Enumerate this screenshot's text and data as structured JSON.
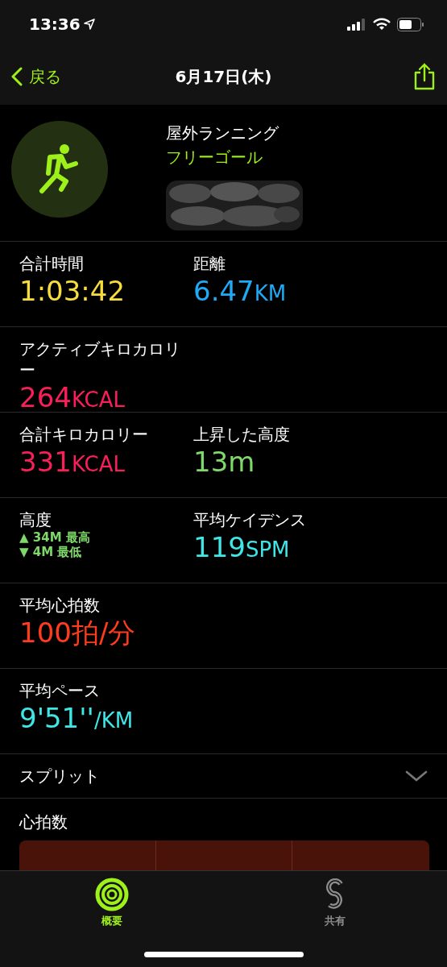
{
  "status_bar": {
    "time": "13:36"
  },
  "nav": {
    "back": "戻る",
    "title": "6月17日(木)"
  },
  "workout": {
    "name": "屋外ランニング",
    "goal": "フリーゴール"
  },
  "rows": [
    {
      "cells": [
        {
          "kind": "metric",
          "label": "合計時間",
          "value": "1:03:42",
          "color": "#f7dc3c"
        },
        {
          "kind": "metric",
          "label": "距離",
          "value": "6.47",
          "unit": "KM",
          "color": "#1eaaf5"
        }
      ]
    },
    {
      "cells": [
        {
          "kind": "metric",
          "label": "アクティブキロカロリー",
          "value": "264",
          "unit": "KCAL",
          "color": "#fa1e5a"
        }
      ]
    },
    {
      "cells": [
        {
          "kind": "metric",
          "label": "合計キロカロリー",
          "value": "331",
          "unit": "KCAL",
          "color": "#fa1e5a"
        },
        {
          "kind": "metric",
          "label": "上昇した高度",
          "value": "13m",
          "color": "#7fd86a"
        }
      ]
    },
    {
      "cells": [
        {
          "kind": "range",
          "label": "高度",
          "high": "▲ 34M 最高",
          "low": "▼ 4M 最低",
          "color": "#7fd86a"
        },
        {
          "kind": "metric",
          "label": "平均ケイデンス",
          "value": "119",
          "unit": "SPM",
          "color": "#3ee6e6"
        }
      ]
    },
    {
      "cells": [
        {
          "kind": "metric",
          "label": "平均心拍数",
          "value": "100拍/分",
          "color": "#ff3b1e"
        }
      ]
    },
    {
      "cells": [
        {
          "kind": "metric",
          "label": "平均ペース",
          "value": "9'51''",
          "unit": "/KM",
          "color": "#3ee6e6"
        }
      ]
    }
  ],
  "splits": {
    "label": "スプリット",
    "expanded": false
  },
  "heart_rate": {
    "label": "心拍数"
  },
  "tabs": [
    {
      "label": "概要",
      "selected": true
    },
    {
      "label": "共有",
      "selected": false
    }
  ]
}
